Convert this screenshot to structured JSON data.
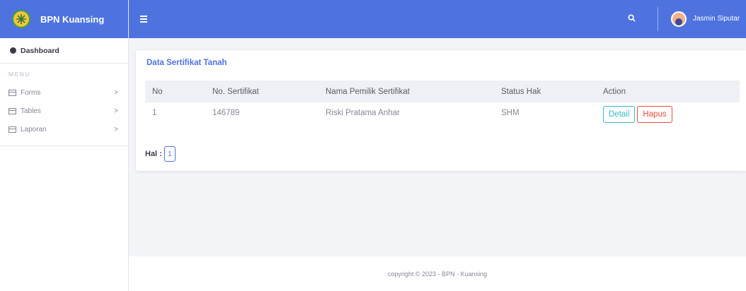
{
  "brand": {
    "name": "BPN Kuansing"
  },
  "sidebar": {
    "dashboard_label": "Dashboard",
    "menu_heading": "MENU",
    "items": [
      {
        "label": "Forms",
        "icon": "form-icon"
      },
      {
        "label": "Tables",
        "icon": "table-icon"
      },
      {
        "label": "Laporan",
        "icon": "report-icon"
      }
    ]
  },
  "topbar": {
    "user_name": "Jasmin Siputar",
    "icons": [
      "menu-toggle-icon",
      "search-icon",
      "avatar"
    ]
  },
  "card": {
    "title": "Data Sertifikat Tanah",
    "columns": [
      "No",
      "No. Sertifikat",
      "Nama Pemilik Sertifikat",
      "Status Hak",
      "Action"
    ],
    "rows": [
      {
        "no": "1",
        "sertifikat": "146789",
        "nama": "Riski Pratama Anhar",
        "status": "SHM",
        "detail_label": "Detail",
        "hapus_label": "Hapus"
      }
    ],
    "pager_label": "Hal :",
    "current_page": "1"
  },
  "footer": {
    "text": "copyright © 2023 - BPN - Kuansing"
  },
  "colors": {
    "primary": "#4e73df",
    "info": "#36b9cc",
    "danger": "#e74a3b",
    "background": "#f3f4f8"
  }
}
